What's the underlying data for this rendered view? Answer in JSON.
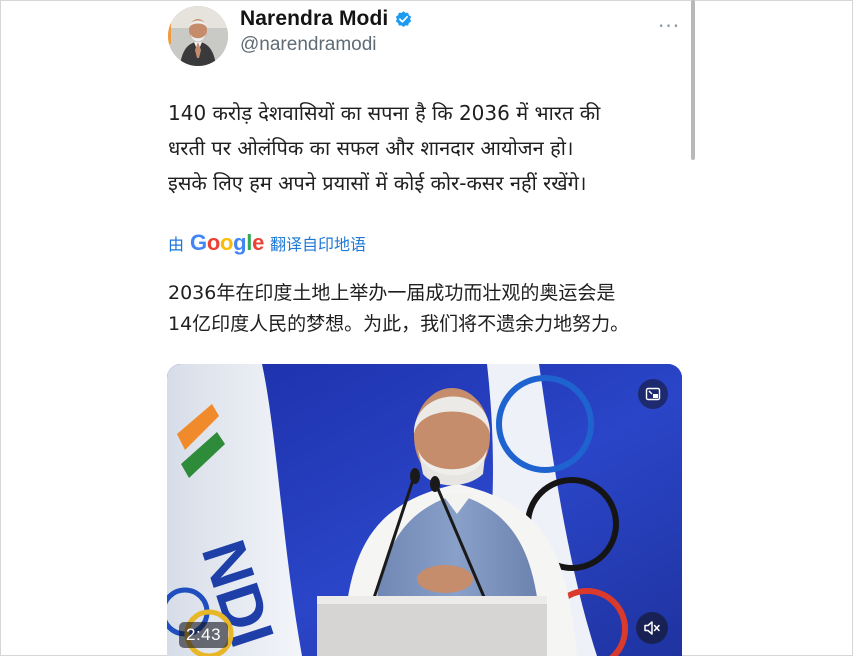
{
  "author": {
    "display_name": "Narendra Modi",
    "handle": "@narendramodi",
    "verified": true
  },
  "more_menu": "···",
  "tweet": {
    "lines": [
      "140 करोड़ देशवासियों का सपना है कि 2036 में भारत की",
      "धरती पर ओलंपिक का सफल और शानदार आयोजन हो।",
      "इसके लिए हम अपने प्रयासों में कोई कोर-कसर नहीं रखेंगे।"
    ]
  },
  "translation": {
    "prefix": "由",
    "brand": [
      "G",
      "o",
      "o",
      "g",
      "l",
      "e"
    ],
    "suffix": "翻译自印地语",
    "lines": [
      "2036年在印度土地上举办一届成功而壮观的奥运会是",
      "14亿印度人民的梦想。为此，我们将不遗余力地努力。"
    ]
  },
  "video": {
    "duration": "2:43",
    "flag_text": "NDI",
    "top_icon": "picture-in-picture-icon",
    "bottom_icon": "speaker-muted-icon"
  },
  "colors": {
    "link_blue": "#1d78d6",
    "verified_blue": "#1d9bf0",
    "stage_blue": "#2438b8",
    "google_blue": "#4285f4",
    "google_red": "#ea4335",
    "google_yellow": "#fbbc05",
    "google_green": "#34a853"
  }
}
